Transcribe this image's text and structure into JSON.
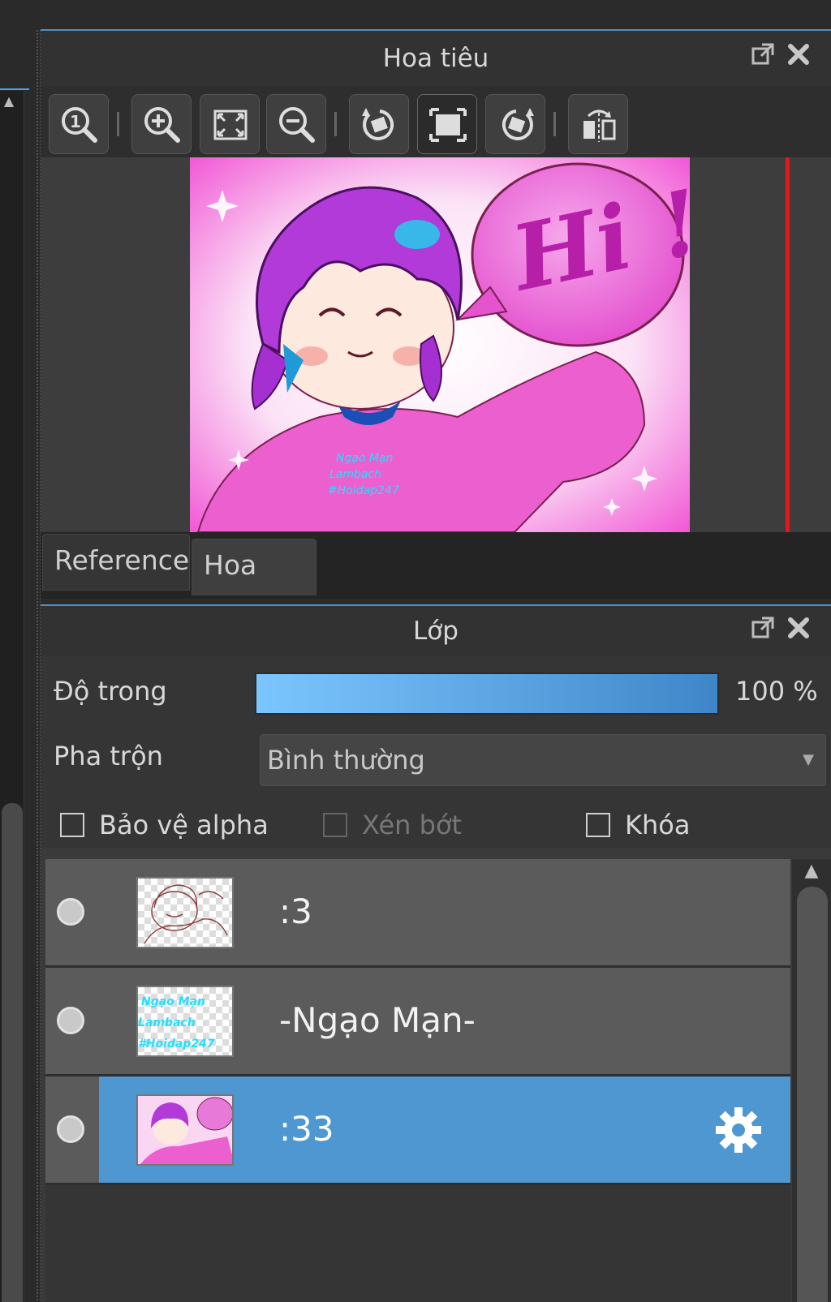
{
  "navigator": {
    "title": "Hoa tiêu",
    "toolbar": [
      {
        "id": "zoom-actual",
        "icon": "zoom-actual-size-icon"
      },
      {
        "id": "zoom-in",
        "icon": "zoom-in-icon"
      },
      {
        "id": "fit",
        "icon": "fit-screen-icon"
      },
      {
        "id": "zoom-out",
        "icon": "zoom-out-icon"
      },
      {
        "id": "rotate-left",
        "icon": "rotate-left-icon"
      },
      {
        "id": "reset-rotation",
        "icon": "reset-view-icon",
        "active": true
      },
      {
        "id": "rotate-right",
        "icon": "rotate-right-icon"
      },
      {
        "id": "flip",
        "icon": "flip-horizontal-icon"
      }
    ],
    "preview_text": "Hi !",
    "tabs": [
      {
        "label": "Reference",
        "active": false
      },
      {
        "label": "Hoa tiêu",
        "active": true
      }
    ]
  },
  "layers": {
    "title": "Lớp",
    "opacity_label": "Độ trong",
    "opacity_value": "100 %",
    "opacity_fraction": 1.0,
    "blend_label": "Pha trộn",
    "blend_value": "Bình thường",
    "checkboxes": {
      "protect_alpha": "Bảo vệ alpha",
      "clipping": "Xén bớt",
      "lock": "Khóa"
    },
    "items": [
      {
        "name": ":3",
        "selected": false
      },
      {
        "name": "-Ngạo Mạn-",
        "selected": false
      },
      {
        "name": ":33",
        "selected": true
      }
    ]
  },
  "colors": {
    "accent": "#4f97d1",
    "panel_bg": "#3a3a3a",
    "title_bg": "#323232"
  }
}
